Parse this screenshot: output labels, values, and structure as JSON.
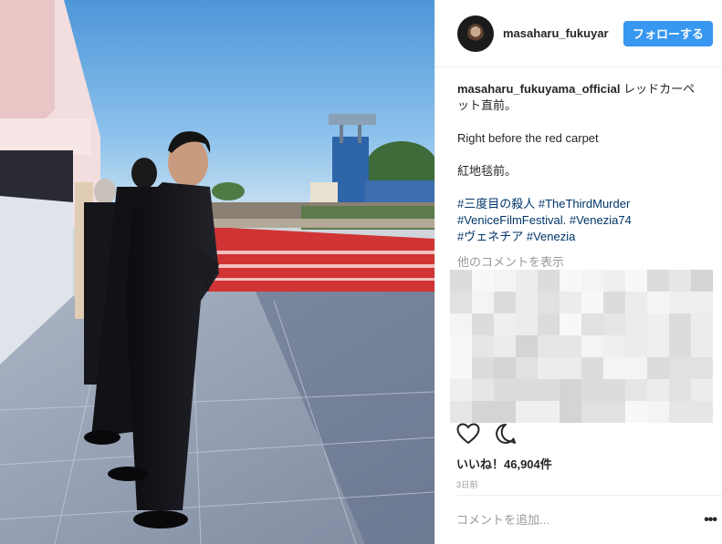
{
  "header": {
    "username": "masaharu_fukuyar",
    "follow_label": "フォローする"
  },
  "caption": {
    "user": "masaharu_fukuyama_official",
    "text_jp": "レッドカーペット直前。",
    "text_en": "Right before the red carpet",
    "text_cn": "紅地毯前。",
    "hashtags": [
      "#三度目の殺人",
      "#TheThirdMurder",
      "#VeniceFilmFestival.",
      "#Venezia74",
      "#ヴェネチア",
      "#Venezia"
    ]
  },
  "comments": {
    "more_label": "他のコメントを表示"
  },
  "actions": {
    "like_icon": "heart-icon",
    "comment_icon": "comment-bubble-icon"
  },
  "likes": {
    "label": "いいね！46,904件"
  },
  "time": {
    "label": "3日前"
  },
  "comment_bar": {
    "placeholder": "コメントを追加...",
    "more_label": "•••"
  }
}
